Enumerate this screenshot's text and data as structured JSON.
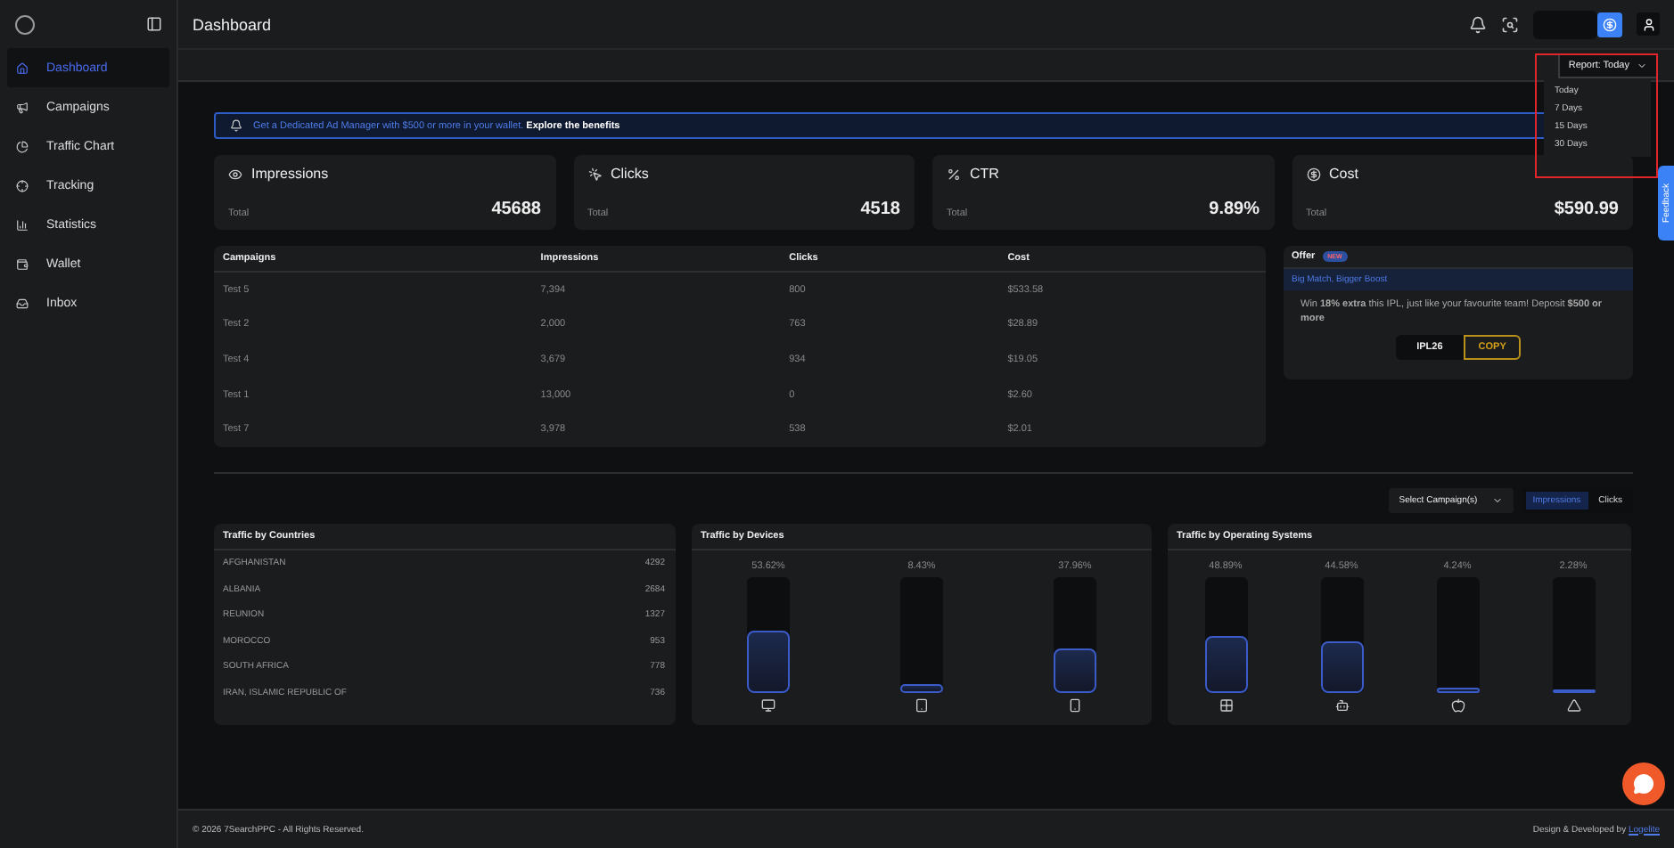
{
  "header": {
    "title": "Dashboard"
  },
  "sidebar": {
    "items": [
      {
        "label": "Dashboard",
        "selected": true
      },
      {
        "label": "Campaigns",
        "selected": false
      },
      {
        "label": "Traffic Chart",
        "selected": false
      },
      {
        "label": "Tracking",
        "selected": false
      },
      {
        "label": "Statistics",
        "selected": false
      },
      {
        "label": "Wallet",
        "selected": false
      },
      {
        "label": "Inbox",
        "selected": false
      }
    ]
  },
  "report": {
    "label": "Report: Today",
    "expanded": true,
    "options": [
      "Today",
      "7 Days",
      "15 Days",
      "30 Days"
    ]
  },
  "banner": {
    "text": "Get a Dedicated Ad Manager with $500 or more in your wallet.",
    "link": "Explore the benefits"
  },
  "stats": [
    {
      "title": "Impressions",
      "sub": "Total",
      "value": "45688"
    },
    {
      "title": "Clicks",
      "sub": "Total",
      "value": "4518"
    },
    {
      "title": "CTR",
      "sub": "Total",
      "value": "9.89%"
    },
    {
      "title": "Cost",
      "sub": "Total",
      "value": "$590.99"
    }
  ],
  "table": {
    "columns": [
      "Campaigns",
      "Impressions",
      "Clicks",
      "Cost"
    ],
    "rows": [
      [
        "Test 5",
        "7,394",
        "800",
        "$533.58"
      ],
      [
        "Test 2",
        "2,000",
        "763",
        "$28.89"
      ],
      [
        "Test 4",
        "3,679",
        "934",
        "$19.05"
      ],
      [
        "Test 1",
        "13,000",
        "0",
        "$2.60"
      ],
      [
        "Test 7",
        "3,978",
        "538",
        "$2.01"
      ]
    ]
  },
  "offer": {
    "title": "Offer",
    "badge": "NEW",
    "headline": "Big Match, Bigger Boost",
    "text": "Win **18% extra** this IPL, just like your favourite team! Deposit **$500 or more**",
    "code": "IPL26",
    "button": "COPY"
  },
  "filters": {
    "select": "Select Campaign(s)",
    "toggles": [
      {
        "label": "Impressions",
        "selected": true
      },
      {
        "label": "Clicks",
        "selected": false
      }
    ]
  },
  "countries": {
    "title": "Traffic by Countries",
    "rows": [
      {
        "name": "AFGHANISTAN",
        "value": "4292"
      },
      {
        "name": "ALBANIA",
        "value": "2684"
      },
      {
        "name": "REUNION",
        "value": "1327"
      },
      {
        "name": "MOROCCO",
        "value": "953"
      },
      {
        "name": "SOUTH AFRICA",
        "value": "778"
      },
      {
        "name": "IRAN, ISLAMIC REPUBLIC OF",
        "value": "736"
      }
    ]
  },
  "devices": {
    "title": "Traffic by Devices",
    "bars": [
      {
        "reading": "53.62%",
        "level": 0.5362
      },
      {
        "reading": "8.43%",
        "level": 0.0843
      },
      {
        "reading": "37.96%",
        "level": 0.3796
      }
    ]
  },
  "os": {
    "title": "Traffic by Operating Systems",
    "bars": [
      {
        "reading": "48.89%",
        "level": 0.4889
      },
      {
        "reading": "44.58%",
        "level": 0.4458
      },
      {
        "reading": "4.24%",
        "level": 0.0424
      },
      {
        "reading": "2.28%",
        "level": 0.0228
      }
    ]
  },
  "feedback": "Feedback",
  "footer": {
    "copyright": "© 2026 7SearchPPC",
    "rights": "- All Rights Reserved.",
    "credit": "Design & Developed by",
    "credit_link": "Logelite"
  }
}
